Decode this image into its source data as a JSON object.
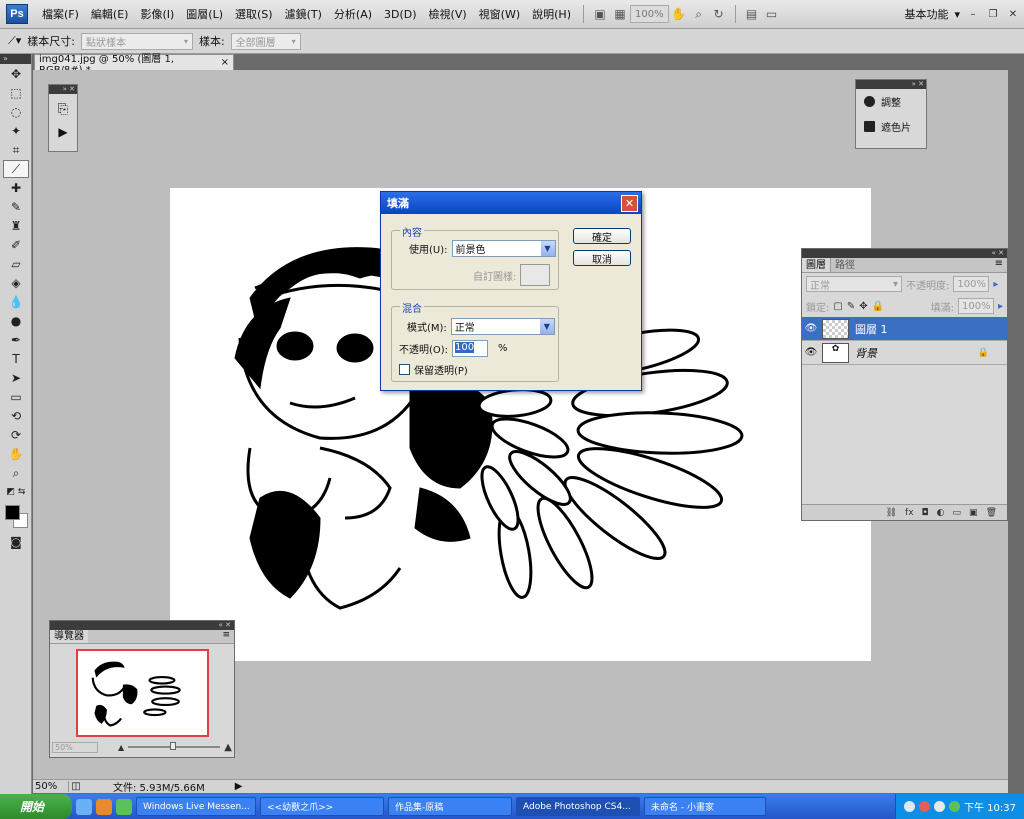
{
  "app": {
    "logo": "Ps",
    "menus": [
      "檔案(F)",
      "編輯(E)",
      "影像(I)",
      "圖層(L)",
      "選取(S)",
      "濾鏡(T)",
      "分析(A)",
      "3D(D)",
      "檢視(V)",
      "視窗(W)",
      "說明(H)"
    ],
    "zoom_level": "100%",
    "workspace": "基本功能"
  },
  "options_bar": {
    "sample_size_label": "樣本尺寸:",
    "sample_size_value": "點狀樣本",
    "sample_label": "樣本:",
    "sample_value": "全部圖層"
  },
  "document": {
    "tab_title": "img041.jpg @ 50% (圖層 1, RGB/8#) *",
    "close_symbol": "×"
  },
  "adjustments": {
    "items": [
      "調整",
      "遮色片"
    ]
  },
  "layers_panel": {
    "tabs": [
      "圖層",
      "路徑"
    ],
    "blend_mode": "正常",
    "opacity_label": "不透明度:",
    "opacity_value": "100%",
    "lock_label": "鎖定:",
    "fill_label": "填滿:",
    "fill_value": "100%",
    "layers": [
      {
        "name": "圖層 1",
        "selected": true
      },
      {
        "name": "背景",
        "selected": false
      }
    ]
  },
  "navigator": {
    "title": "導覽器",
    "zoom": "50%"
  },
  "status": {
    "zoom": "50%",
    "file_info": "文件: 5.93M/5.66M"
  },
  "fill_dialog": {
    "title": "填滿",
    "content_group": "內容",
    "use_label": "使用(U):",
    "use_value": "前景色",
    "custom_pattern_label": "自訂圖樣:",
    "blend_group": "混合",
    "mode_label": "模式(M):",
    "mode_value": "正常",
    "opacity_label": "不透明(O):",
    "opacity_value": "100",
    "opacity_unit": "%",
    "preserve_transparency": "保留透明(P)",
    "ok_label": "確定",
    "cancel_label": "取消"
  },
  "taskbar": {
    "start_label": "開始",
    "tasks": [
      "Windows Live Messen...",
      "<<幼獸之爪>>",
      "作品集-原稿",
      "Adobe Photoshop CS4...",
      "未命名 - 小畫家"
    ],
    "active_task": 3,
    "clock": "下午 10:37"
  }
}
